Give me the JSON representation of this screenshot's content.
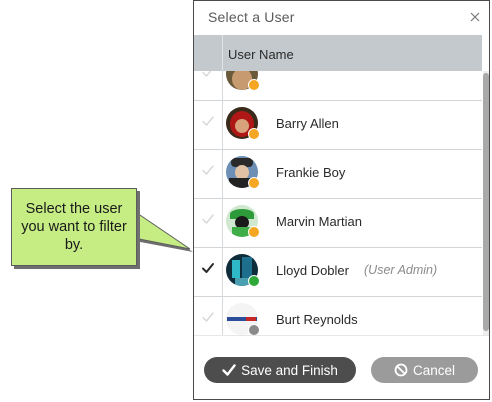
{
  "callout": {
    "text": "Select the user you want to filter by."
  },
  "dialog": {
    "title": "Select a User",
    "column_header": "User Name"
  },
  "users": [
    {
      "name": "",
      "role": "",
      "selected": false,
      "status_color": "#f5a623"
    },
    {
      "name": "Barry Allen",
      "role": "",
      "selected": false,
      "status_color": "#f5a623"
    },
    {
      "name": "Frankie Boy",
      "role": "",
      "selected": false,
      "status_color": "#f5a623"
    },
    {
      "name": "Marvin Martian",
      "role": "",
      "selected": false,
      "status_color": "#f5a623"
    },
    {
      "name": "Lloyd Dobler",
      "role": "(User Admin)",
      "selected": true,
      "status_color": "#2ea836"
    },
    {
      "name": "Burt Reynolds",
      "role": "",
      "selected": false,
      "status_color": "#8a8a8a"
    }
  ],
  "buttons": {
    "save_label": "Save and Finish",
    "cancel_label": "Cancel"
  },
  "icons": {
    "close": "close-icon",
    "save": "checkmark-icon",
    "cancel": "prohibited-icon",
    "row_check": "checkmark-icon"
  },
  "colors": {
    "header_bg": "#c4c9cd",
    "callout_bg": "#c6ec84",
    "save_button": "#4d4d4d",
    "cancel_button": "#9b9b9b",
    "status_away": "#f5a623",
    "status_online": "#2ea836",
    "status_offline": "#8a8a8a"
  }
}
